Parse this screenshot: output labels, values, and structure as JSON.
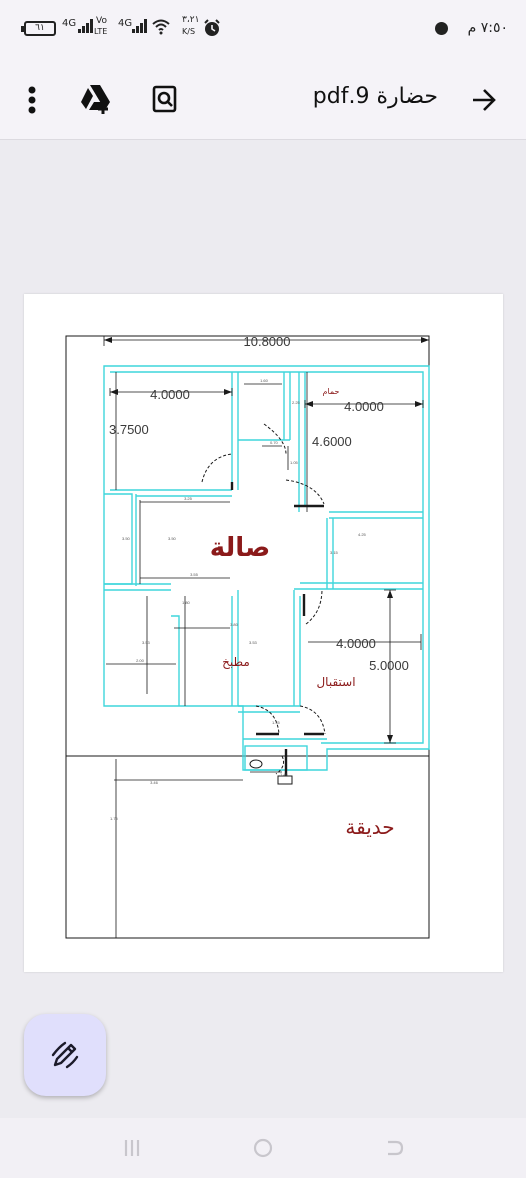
{
  "status_bar": {
    "battery": "٦١",
    "net1": "4G",
    "volte_top": "Vo",
    "volte_bottom": "LTE",
    "net2": "4G",
    "speed_top": "٣،٢١",
    "speed_bottom": "K/S",
    "time": "٧:٥٠ م"
  },
  "app_bar": {
    "title": "حضارة 9.pdf"
  },
  "floor_plan": {
    "overall_width": "10.8000",
    "room1_width": "4.0000",
    "room1_height": "3.7500",
    "bath_label": "حمام",
    "room2_width": "4.0000",
    "room2_height": "4.6000",
    "hall_label": "صالة",
    "kitchen_label": "مطبخ",
    "reception_width": "4.0000",
    "reception_height": "5.0000",
    "reception_label": "استقبال",
    "garden_label": "حديقة",
    "small_dims": [
      "1.60",
      "2.25",
      "0.70",
      "1.05",
      "3.25",
      "4.25",
      "3.50",
      "3.50",
      "3.15",
      "3.55",
      "1.80",
      "3.80",
      "3.53",
      "2.00",
      "3.53",
      "1.45",
      "1.46",
      "3.46",
      "1.75"
    ]
  },
  "colors": {
    "wall": "#3fd6dc",
    "dim": "#1a1a1a",
    "label": "#8b1a1a",
    "fab": "#e0dffc"
  },
  "icons": {
    "back": "arrow-right-icon",
    "search": "search-document-icon",
    "drive": "google-drive-add-icon",
    "more": "more-vertical-icon",
    "edit": "pen-edit-icon"
  }
}
